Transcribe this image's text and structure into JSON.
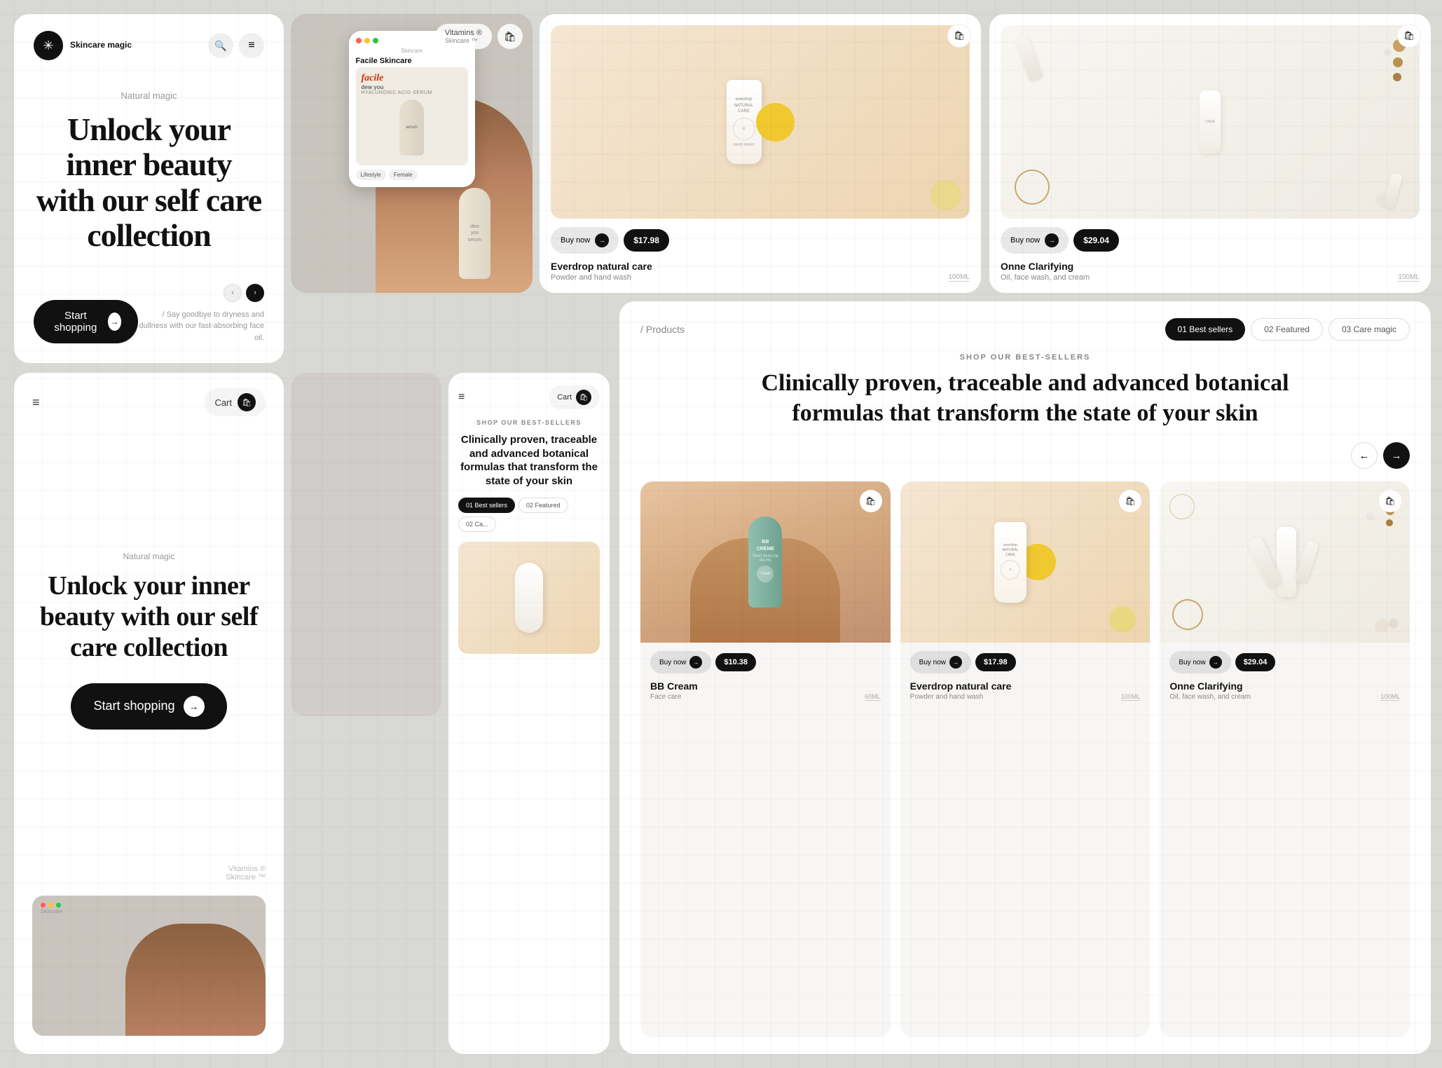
{
  "app": {
    "title": "Skincare magic",
    "logo_symbol": "✳"
  },
  "hero": {
    "subtitle": "Natural magic",
    "title": "Unlock your inner beauty with our self care collection",
    "cta_label": "Start shopping",
    "description": "/ Say goodbye to dryness and dullness with our fast-absorbing face oil.",
    "nav": {
      "search_label": "🔍",
      "menu_label": "☰"
    }
  },
  "hero_mobile": {
    "subtitle": "Natural magic",
    "title": "Unlock your inner beauty with our self care collection",
    "cta_label": "Start shopping",
    "cart_label": "Cart",
    "vitamins_label": "Vitamins ®",
    "skincare_label": "Skincare ™"
  },
  "mini_phone": {
    "nav": {
      "menu_label": "☰",
      "cart_label": "Cart"
    },
    "section_title": "SHOP OUR BEST-SELLERS",
    "heading": "Clinically proven, traceable and advanced botanical formulas that transform the state of your skin",
    "filters": [
      {
        "label": "01 Best sellers",
        "active": true
      },
      {
        "label": "02 Featured",
        "active": false
      },
      {
        "label": "02 Ca...",
        "active": false
      }
    ]
  },
  "phone_preview": {
    "vitamins_label": "Vitamins ®",
    "skincare_label": "Skincare ™",
    "inner": {
      "brand": "Skincare",
      "nav_dots": "●●●",
      "product_title": "Facile Skincare",
      "product_subtitle": "facile",
      "tagline": "dew you",
      "series": "HYALURONIC ACID SERUM",
      "label1": "Lifestyle",
      "label2": "Female"
    }
  },
  "products_top": [
    {
      "id": "everdrop",
      "name": "Everdrop natural care",
      "desc": "Powder and hand wash",
      "size": "100ML",
      "price": "$17.98",
      "buy_label": "Buy now",
      "bg_color": "#F5E6D3"
    },
    {
      "id": "onne",
      "name": "Onne Clarifying",
      "desc": "Oil, face wash, and cream",
      "size": "100ML",
      "price": "$29.04",
      "buy_label": "Buy now",
      "bg_color": "#F8F6F2"
    }
  ],
  "products_section": {
    "breadcrumb": "/ Products",
    "section_overline": "SHOP OUR BEST-SELLERS",
    "heading": "Clinically proven, traceable and advanced botanical formulas that transform the state of your skin",
    "filters": [
      {
        "label": "01 Best sellers",
        "active": true
      },
      {
        "label": "02 Featured",
        "active": false
      },
      {
        "label": "03 Care magic",
        "active": false
      }
    ],
    "products": [
      {
        "id": "bb_cream",
        "name": "BB Cream",
        "sub": "Face care",
        "size": "60ML",
        "price": "$10.38",
        "buy_label": "Buy now",
        "bg": "peach"
      },
      {
        "id": "everdrop2",
        "name": "Everdrop natural care",
        "sub": "Powder and hand wash",
        "size": "100ML",
        "price": "$17.98",
        "buy_label": "Buy now",
        "bg": "warm"
      },
      {
        "id": "onne2",
        "name": "Onne Clarifying",
        "sub": "Oil, face wash, and cream",
        "size": "100ML",
        "price": "$29.04",
        "buy_label": "Buy now",
        "bg": "light"
      }
    ]
  },
  "icons": {
    "cart": "🛍",
    "search": "🔍",
    "arrow_right": "→",
    "arrow_left": "←",
    "menu": "≡",
    "star": "✦"
  }
}
